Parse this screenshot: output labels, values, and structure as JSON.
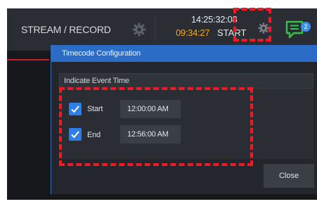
{
  "toolbar": {
    "stream_record_label": "STREAM / RECORD",
    "clock": "14:25:32:08",
    "timecode": "09:34:27",
    "start_label": "START",
    "notification_count": "2"
  },
  "dialog": {
    "title": "Timecode Configuration",
    "section_title": "Indicate Event Time",
    "rows": [
      {
        "label": "Start",
        "checked": true,
        "time": "12:00:00 AM"
      },
      {
        "label": "End",
        "checked": true,
        "time": "12:56:00 AM"
      }
    ],
    "close_label": "Close"
  },
  "colors": {
    "accent_blue": "#2b6cc6",
    "timecode_orange": "#f0a824",
    "annotation_red": "#ee1b24",
    "chat_green": "#35c24a"
  },
  "icons": [
    "gear-icon",
    "chat-icon",
    "checkmark-icon"
  ]
}
